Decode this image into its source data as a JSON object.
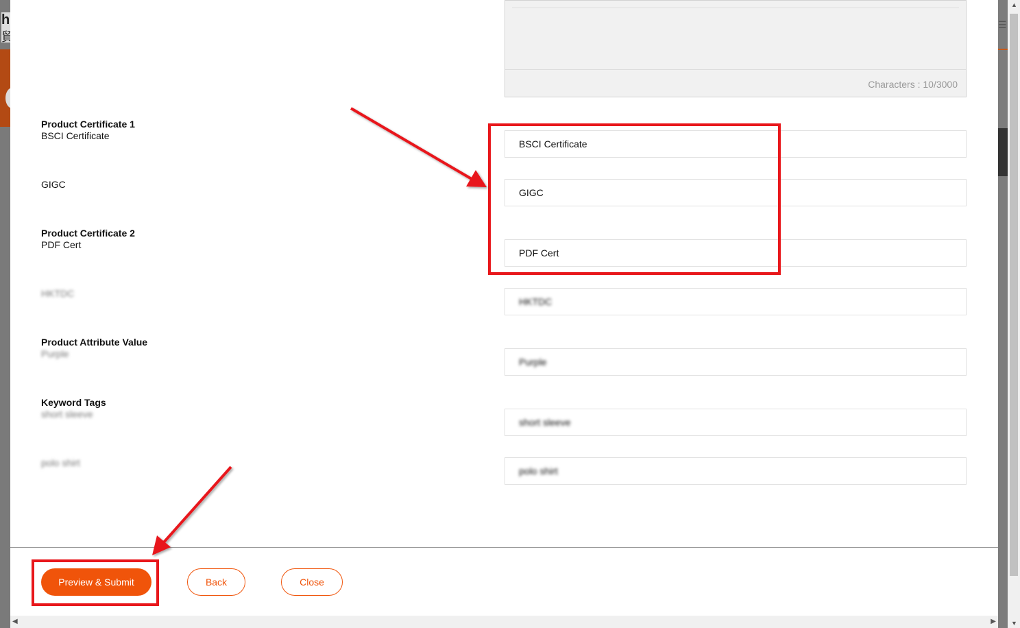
{
  "textarea": {
    "counter": "Characters : 10/3000"
  },
  "fields": [
    {
      "title": "Product Certificate 1",
      "label": "BSCI Certificate",
      "value": "BSCI Certificate"
    },
    {
      "title": "",
      "label": "GIGC",
      "value": "GIGC"
    },
    {
      "title": "Product Certificate 2",
      "label": "PDF Cert",
      "value": "PDF Cert"
    },
    {
      "title": "",
      "label": "HKTDC",
      "value": "HKTDC"
    },
    {
      "title": "Product Attribute Value",
      "label": "Purple",
      "value": "Purple"
    },
    {
      "title": "Keyword Tags",
      "label": "short sleeve",
      "value": "short sleeve"
    },
    {
      "title": "",
      "label": "polo shirt",
      "value": "polo shirt"
    }
  ],
  "footer": {
    "preview_submit_label": "Preview & Submit",
    "back_label": "Back",
    "close_label": "Close"
  },
  "colors": {
    "accent": "#f0540a",
    "annotation": "#e8171b"
  },
  "background": {
    "logo_letter": "h",
    "logo_cjk": "貿"
  }
}
